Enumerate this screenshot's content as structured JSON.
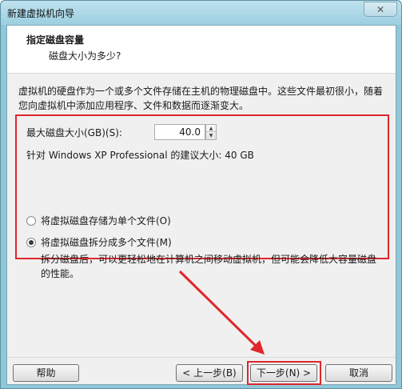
{
  "window": {
    "title": "新建虚拟机向导"
  },
  "header": {
    "title": "指定磁盘容量",
    "subtitle": "磁盘大小为多少?"
  },
  "description": "虚拟机的硬盘作为一个或多个文件存储在主机的物理磁盘中。这些文件最初很小，随着您向虚拟机中添加应用程序、文件和数据而逐渐变大。",
  "disk": {
    "max_size_label": "最大磁盘大小(GB)(S):",
    "max_size_value": "40.0",
    "recommend_text": "针对 Windows XP Professional 的建议大小: 40 GB",
    "option_single": "将虚拟磁盘存储为单个文件(O)",
    "option_split": "将虚拟磁盘拆分成多个文件(M)",
    "selected_option": "split",
    "split_description": "拆分磁盘后，可以更轻松地在计算机之间移动虚拟机，但可能会降低大容量磁盘的性能。"
  },
  "buttons": {
    "help": "帮助",
    "back": "< 上一步(B)",
    "next": "下一步(N) >",
    "cancel": "取消"
  },
  "colors": {
    "highlight": "#e0272c",
    "window_frame": "#8fc8d8"
  }
}
